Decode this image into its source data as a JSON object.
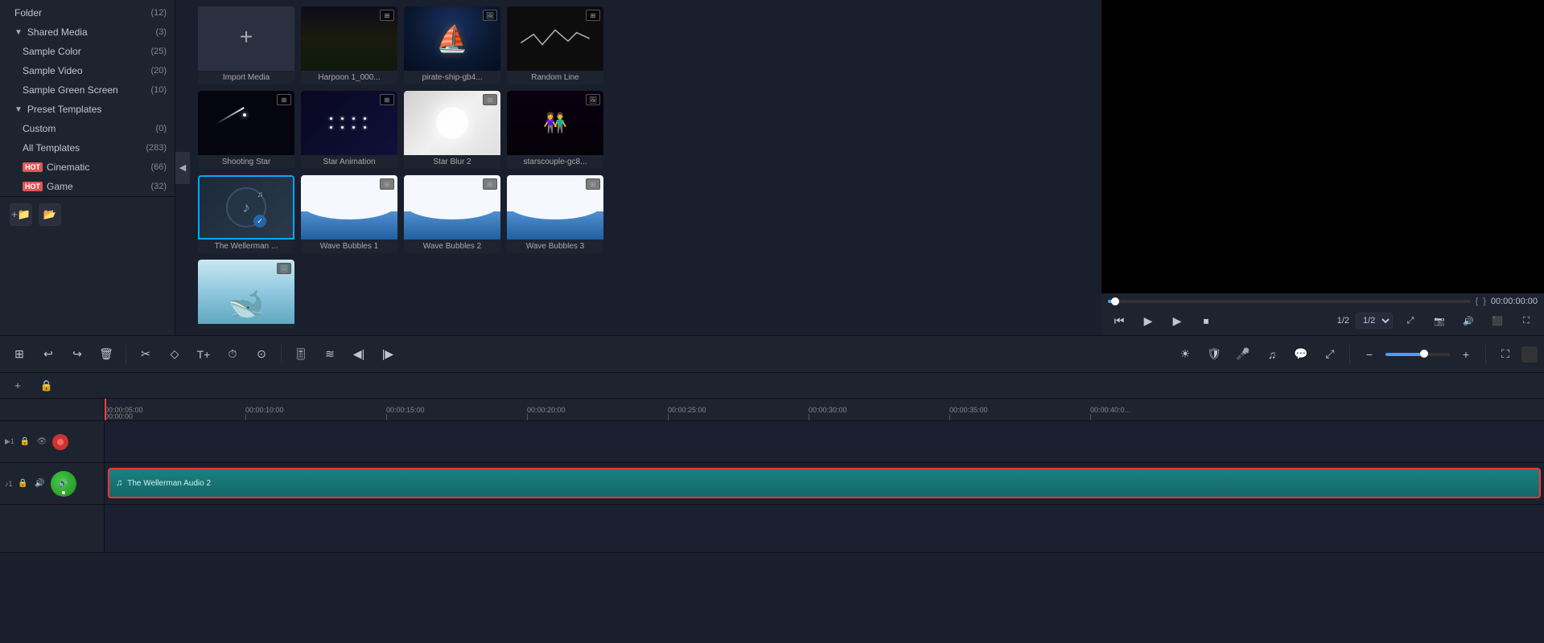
{
  "sidebar": {
    "items": [
      {
        "label": "Folder",
        "count": "(12)",
        "indent": 1,
        "expandable": false
      },
      {
        "label": "Shared Media",
        "count": "(3)",
        "indent": 1,
        "expandable": true,
        "expanded": true
      },
      {
        "label": "Sample Color",
        "count": "(25)",
        "indent": 2,
        "expandable": false
      },
      {
        "label": "Sample Video",
        "count": "(20)",
        "indent": 2,
        "expandable": false
      },
      {
        "label": "Sample Green Screen",
        "count": "(10)",
        "indent": 2,
        "expandable": false
      },
      {
        "label": "Preset Templates",
        "count": "",
        "indent": 1,
        "expandable": true,
        "expanded": true
      },
      {
        "label": "Custom",
        "count": "(0)",
        "indent": 2,
        "expandable": false
      },
      {
        "label": "All Templates",
        "count": "(283)",
        "indent": 2,
        "expandable": false
      },
      {
        "label": "Cinematic",
        "count": "(66)",
        "indent": 2,
        "expandable": false,
        "hot": true
      },
      {
        "label": "Game",
        "count": "(32)",
        "indent": 2,
        "expandable": false,
        "hot": true
      }
    ],
    "add_folder_label": "➕",
    "folder_icon_label": "📁"
  },
  "media_grid": {
    "items": [
      {
        "id": "import",
        "label": "Import Media",
        "type": "import"
      },
      {
        "id": "harpoon",
        "label": "Harpoon 1_000...",
        "type": "video"
      },
      {
        "id": "pirateship",
        "label": "pirate-ship-gb4...",
        "type": "image"
      },
      {
        "id": "randomline",
        "label": "Random Line",
        "type": "video"
      },
      {
        "id": "shootingstar",
        "label": "Shooting Star",
        "type": "video"
      },
      {
        "id": "staranimation",
        "label": "Star Animation",
        "type": "video"
      },
      {
        "id": "starblur2",
        "label": "Star Blur 2",
        "type": "video"
      },
      {
        "id": "starscouple",
        "label": "starscouple-gc8...",
        "type": "image"
      },
      {
        "id": "wellerman",
        "label": "The Wellerman ...",
        "type": "audio",
        "selected": true
      },
      {
        "id": "wavebubbles1",
        "label": "Wave Bubbles 1",
        "type": "video"
      },
      {
        "id": "wavebubbles2",
        "label": "Wave Bubbles 2",
        "type": "video"
      },
      {
        "id": "wavebubbles3",
        "label": "Wave Bubbles 3",
        "type": "video"
      },
      {
        "id": "whale",
        "label": "",
        "type": "image"
      }
    ]
  },
  "toolbar": {
    "buttons": [
      {
        "name": "apps-grid",
        "icon": "⊞"
      },
      {
        "name": "undo",
        "icon": "↩"
      },
      {
        "name": "redo",
        "icon": "↪"
      },
      {
        "name": "delete",
        "icon": "🗑"
      },
      {
        "name": "cut",
        "icon": "✂"
      },
      {
        "name": "draw",
        "icon": "✏"
      },
      {
        "name": "text",
        "icon": "T"
      },
      {
        "name": "timer",
        "icon": "⏱"
      },
      {
        "name": "clock",
        "icon": "⏰"
      },
      {
        "name": "audio-adjust",
        "icon": "🎚"
      },
      {
        "name": "waveform",
        "icon": "≋"
      },
      {
        "name": "filter-left",
        "icon": "◀"
      },
      {
        "name": "filter-right",
        "icon": "▶"
      }
    ],
    "right_buttons": [
      {
        "name": "sun",
        "icon": "☀"
      },
      {
        "name": "shield",
        "icon": "🛡"
      },
      {
        "name": "mic",
        "icon": "🎤"
      },
      {
        "name": "music-note",
        "icon": "♫"
      },
      {
        "name": "subtitle",
        "icon": "💬"
      },
      {
        "name": "transform",
        "icon": "⤢"
      },
      {
        "name": "zoom-out",
        "icon": "−"
      },
      {
        "name": "zoom-in",
        "icon": "+"
      },
      {
        "name": "fullscreen",
        "icon": "⛶"
      },
      {
        "name": "color-block",
        "icon": "■"
      }
    ],
    "zoom_level": "60%"
  },
  "timeline": {
    "ruler_marks": [
      "00:00:00",
      "00:00:05:00",
      "00:00:10:00",
      "00:00:15:00",
      "00:00:20:00",
      "00:00:25:00",
      "00:00:30:00",
      "00:00:35:00",
      "00:00:40:0..."
    ],
    "tracks": [
      {
        "id": "track1",
        "type": "video",
        "badge": "▶1",
        "lock": false,
        "mute": false,
        "clips": []
      },
      {
        "id": "track2",
        "type": "audio",
        "badge": "♪1",
        "lock": false,
        "mute": false,
        "volume_circle": true,
        "clips": [
          {
            "label": "The Wellerman Audio 2",
            "start": 0,
            "end": 100
          }
        ]
      }
    ]
  },
  "player": {
    "current_time": "00:00:00:00",
    "total_time": "1/2",
    "bracket_left": "{",
    "bracket_right": "}",
    "progress_pct": 2
  },
  "colors": {
    "bg_dark": "#1a1f2e",
    "bg_medium": "#1e2330",
    "accent_blue": "#4a9eff",
    "accent_red": "#ff3333",
    "accent_teal": "#1a8080",
    "text_primary": "#c8cdd8",
    "text_muted": "#888"
  }
}
